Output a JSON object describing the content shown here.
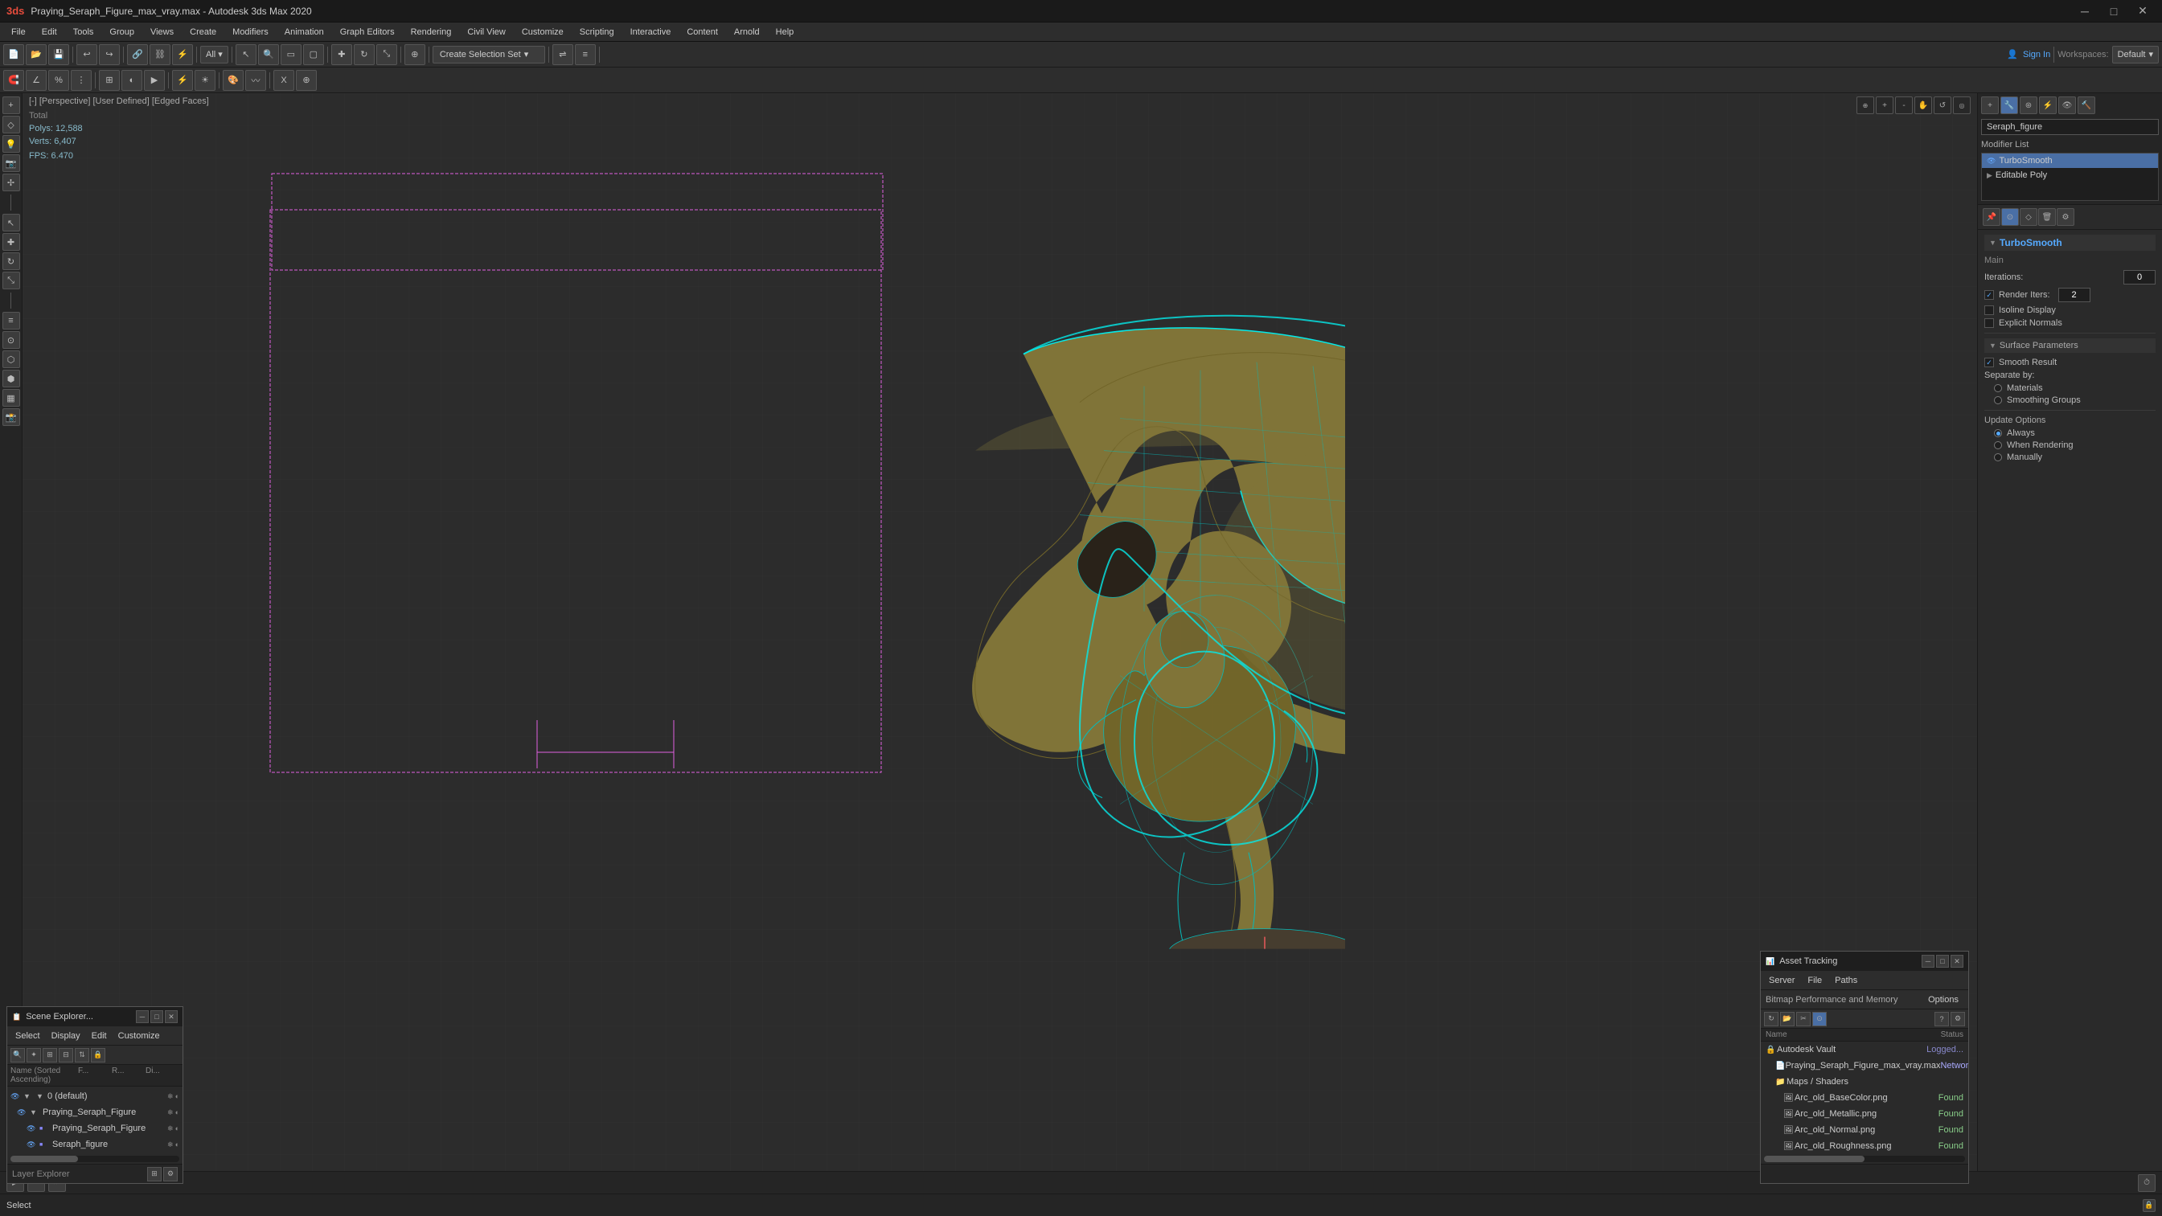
{
  "titlebar": {
    "title": "Praying_Seraph_Figure_max_vray.max - Autodesk 3ds Max 2020",
    "min": "─",
    "max": "□",
    "close": "✕"
  },
  "menu": {
    "items": [
      "File",
      "Edit",
      "Tools",
      "Group",
      "Views",
      "Create",
      "Modifiers",
      "Animation",
      "Graph Editors",
      "Rendering",
      "Civil View",
      "Customize",
      "Scripting",
      "Interactive",
      "Content",
      "Arnold",
      "Help"
    ]
  },
  "toolbar1": {
    "create_selection_set": "Create Selection Set",
    "workspaces_label": "Workspaces:",
    "workspaces_value": "Default",
    "sign_in": "Sign In"
  },
  "viewport": {
    "label": "[-] [Perspective] [User Defined] [Edged Faces]",
    "stats": {
      "polys_label": "Polys:",
      "polys_value": "12,588",
      "verts_label": "Verts:",
      "verts_value": "6,407",
      "fps_label": "FPS:",
      "fps_value": "6.470",
      "total": "Total"
    }
  },
  "right_panel": {
    "object_name": "Seraph_figure",
    "modifier_list_label": "Modifier List",
    "modifiers": [
      {
        "name": "TurboSmooth",
        "active": true
      },
      {
        "name": "Editable Poly",
        "active": false
      }
    ],
    "turbosmooth": {
      "title": "TurboSmooth",
      "main_label": "Main",
      "iterations_label": "Iterations:",
      "iterations_value": "0",
      "render_iters_label": "Render Iters:",
      "render_iters_value": "2",
      "isoline_display": "Isoline Display",
      "explicit_normals": "Explicit Normals",
      "surface_params_title": "Surface Parameters",
      "smooth_result_label": "Smooth Result",
      "smooth_result_checked": true,
      "separate_by_label": "Separate by:",
      "materials_label": "Materials",
      "materials_checked": false,
      "smoothing_groups_label": "Smoothing Groups",
      "smoothing_groups_checked": false,
      "update_options_label": "Update Options",
      "always_label": "Always",
      "always_selected": true,
      "when_rendering_label": "When Rendering",
      "manually_label": "Manually"
    }
  },
  "scene_explorer": {
    "title": "Scene Explorer...",
    "toolbar_items": [
      "Select",
      "Display",
      "Edit",
      "Customize"
    ],
    "columns": [
      "Name (Sorted Ascending)",
      "F...",
      "R...",
      "Di..."
    ],
    "items": [
      {
        "name": "0 (default)",
        "indent": 1,
        "type": "group"
      },
      {
        "name": "Praying_Seraph_Figure",
        "indent": 2,
        "type": "object",
        "selected": true
      },
      {
        "name": "Praying_Seraph_Figure",
        "indent": 3,
        "type": "object"
      },
      {
        "name": "Seraph_figure",
        "indent": 3,
        "type": "object"
      }
    ],
    "footer_label": "Layer Explorer"
  },
  "asset_tracking": {
    "title": "Asset Tracking",
    "toolbar_items": [
      "Server",
      "File",
      "Paths"
    ],
    "options_label": "Bitmap Performance and Memory",
    "options_action": "Options",
    "col_name": "Name",
    "col_status": "Status",
    "items": [
      {
        "name": "Autodesk Vault",
        "indent": 0,
        "status": "Logged...",
        "status_type": "logged",
        "icon": "🔒"
      },
      {
        "name": "Praying_Seraph_Figure_max_vray.max",
        "indent": 1,
        "status": "Networ...",
        "status_type": "network",
        "icon": "📄"
      },
      {
        "name": "Maps / Shaders",
        "indent": 1,
        "status": "",
        "icon": "📁"
      },
      {
        "name": "Arc_old_BaseColor.png",
        "indent": 2,
        "status": "Found",
        "icon": "🖼"
      },
      {
        "name": "Arc_old_Metallic.png",
        "indent": 2,
        "status": "Found",
        "icon": "🖼"
      },
      {
        "name": "Arc_old_Normal.png",
        "indent": 2,
        "status": "Found",
        "icon": "🖼"
      },
      {
        "name": "Arc_old_Roughness.png",
        "indent": 2,
        "status": "Found",
        "icon": "🖼"
      }
    ]
  },
  "statusbar": {
    "select_label": "Select"
  }
}
